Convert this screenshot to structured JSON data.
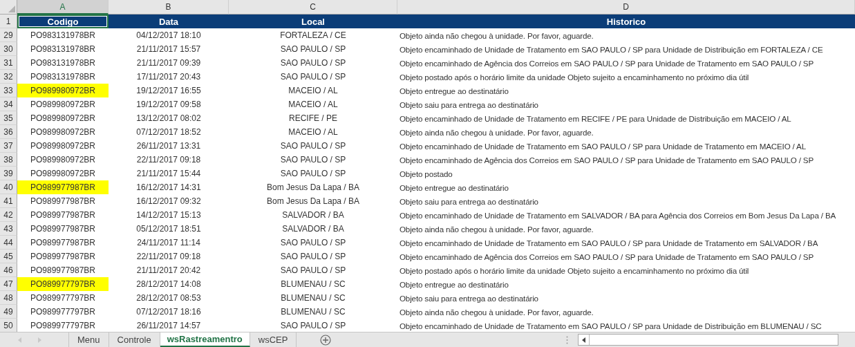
{
  "columns": [
    {
      "label": "A",
      "selected": true
    },
    {
      "label": "B",
      "selected": false
    },
    {
      "label": "C",
      "selected": false
    },
    {
      "label": "D",
      "selected": false
    }
  ],
  "header_row": {
    "number": "1",
    "cells": [
      "Codigo",
      "Data",
      "Local",
      "Historico"
    ]
  },
  "rows": [
    {
      "number": "29",
      "codigo": "PO983131978BR",
      "data": "04/12/2017 18:10",
      "local": "FORTALEZA / CE",
      "historico": "Objeto ainda não chegou à unidade. Por favor, aguarde.",
      "highlighted": false
    },
    {
      "number": "30",
      "codigo": "PO983131978BR",
      "data": "21/11/2017 15:57",
      "local": "SAO PAULO / SP",
      "historico": "Objeto encaminhado de Unidade de Tratamento em SAO PAULO / SP para Unidade de Distribuição em FORTALEZA / CE",
      "highlighted": false
    },
    {
      "number": "31",
      "codigo": "PO983131978BR",
      "data": "21/11/2017 09:39",
      "local": "SAO PAULO / SP",
      "historico": "Objeto encaminhado de Agência dos Correios em SAO PAULO / SP para Unidade de Tratamento em SAO PAULO / SP",
      "highlighted": false
    },
    {
      "number": "32",
      "codigo": "PO983131978BR",
      "data": "17/11/2017 20:43",
      "local": "SAO PAULO / SP",
      "historico": "Objeto postado após o horário limite da unidade Objeto sujeito a encaminhamento no próximo dia útil",
      "highlighted": false
    },
    {
      "number": "33",
      "codigo": "PO989980972BR",
      "data": "19/12/2017 16:55",
      "local": "MACEIO / AL",
      "historico": "Objeto entregue ao destinatário",
      "highlighted": true
    },
    {
      "number": "34",
      "codigo": "PO989980972BR",
      "data": "19/12/2017 09:58",
      "local": "MACEIO / AL",
      "historico": "Objeto saiu para entrega ao destinatário",
      "highlighted": false
    },
    {
      "number": "35",
      "codigo": "PO989980972BR",
      "data": "13/12/2017 08:02",
      "local": "RECIFE / PE",
      "historico": "Objeto encaminhado de Unidade de Tratamento em RECIFE / PE para Unidade de Distribuição em MACEIO / AL",
      "highlighted": false
    },
    {
      "number": "36",
      "codigo": "PO989980972BR",
      "data": "07/12/2017 18:52",
      "local": "MACEIO / AL",
      "historico": "Objeto ainda não chegou à unidade. Por favor, aguarde.",
      "highlighted": false
    },
    {
      "number": "37",
      "codigo": "PO989980972BR",
      "data": "26/11/2017 13:31",
      "local": "SAO PAULO / SP",
      "historico": "Objeto encaminhado de Unidade de Tratamento em SAO PAULO / SP para Unidade de Tratamento em MACEIO / AL",
      "highlighted": false
    },
    {
      "number": "38",
      "codigo": "PO989980972BR",
      "data": "22/11/2017 09:18",
      "local": "SAO PAULO / SP",
      "historico": "Objeto encaminhado de Agência dos Correios em SAO PAULO / SP para Unidade de Tratamento em SAO PAULO / SP",
      "highlighted": false
    },
    {
      "number": "39",
      "codigo": "PO989980972BR",
      "data": "21/11/2017 15:44",
      "local": "SAO PAULO / SP",
      "historico": "Objeto postado",
      "highlighted": false
    },
    {
      "number": "40",
      "codigo": "PO989977987BR",
      "data": "16/12/2017 14:31",
      "local": "Bom Jesus Da Lapa / BA",
      "historico": "Objeto entregue ao destinatário",
      "highlighted": true
    },
    {
      "number": "41",
      "codigo": "PO989977987BR",
      "data": "16/12/2017 09:32",
      "local": "Bom Jesus Da Lapa / BA",
      "historico": "Objeto saiu para entrega ao destinatário",
      "highlighted": false
    },
    {
      "number": "42",
      "codigo": "PO989977987BR",
      "data": "14/12/2017 15:13",
      "local": "SALVADOR / BA",
      "historico": "Objeto encaminhado de Unidade de Tratamento em SALVADOR / BA para Agência dos Correios em Bom Jesus Da Lapa / BA",
      "highlighted": false
    },
    {
      "number": "43",
      "codigo": "PO989977987BR",
      "data": "05/12/2017 18:51",
      "local": "SALVADOR / BA",
      "historico": "Objeto ainda não chegou à unidade. Por favor, aguarde.",
      "highlighted": false
    },
    {
      "number": "44",
      "codigo": "PO989977987BR",
      "data": "24/11/2017 11:14",
      "local": "SAO PAULO / SP",
      "historico": "Objeto encaminhado de Unidade de Tratamento em SAO PAULO / SP para Unidade de Tratamento em SALVADOR / BA",
      "highlighted": false
    },
    {
      "number": "45",
      "codigo": "PO989977987BR",
      "data": "22/11/2017 09:18",
      "local": "SAO PAULO / SP",
      "historico": "Objeto encaminhado de Agência dos Correios em SAO PAULO / SP para Unidade de Tratamento em SAO PAULO / SP",
      "highlighted": false
    },
    {
      "number": "46",
      "codigo": "PO989977987BR",
      "data": "21/11/2017 20:42",
      "local": "SAO PAULO / SP",
      "historico": "Objeto postado após o horário limite da unidade Objeto sujeito a encaminhamento no próximo dia útil",
      "highlighted": false
    },
    {
      "number": "47",
      "codigo": "PO989977797BR",
      "data": "28/12/2017 14:08",
      "local": "BLUMENAU / SC",
      "historico": "Objeto entregue ao destinatário",
      "highlighted": true
    },
    {
      "number": "48",
      "codigo": "PO989977797BR",
      "data": "28/12/2017 08:53",
      "local": "BLUMENAU / SC",
      "historico": "Objeto saiu para entrega ao destinatário",
      "highlighted": false
    },
    {
      "number": "49",
      "codigo": "PO989977797BR",
      "data": "07/12/2017 18:16",
      "local": "BLUMENAU / SC",
      "historico": "Objeto ainda não chegou à unidade. Por favor, aguarde.",
      "highlighted": false
    },
    {
      "number": "50",
      "codigo": "PO989977797BR",
      "data": "26/11/2017 14:57",
      "local": "SAO PAULO / SP",
      "historico": "Objeto encaminhado de Unidade de Tratamento em SAO PAULO / SP para Unidade de Distribuição em BLUMENAU / SC",
      "highlighted": false
    }
  ],
  "sheet_tabs": [
    {
      "label": "Menu",
      "selected": false
    },
    {
      "label": "Controle",
      "selected": false
    },
    {
      "label": "wsRastreamentro",
      "selected": true
    },
    {
      "label": "wsCEP",
      "selected": false
    }
  ]
}
